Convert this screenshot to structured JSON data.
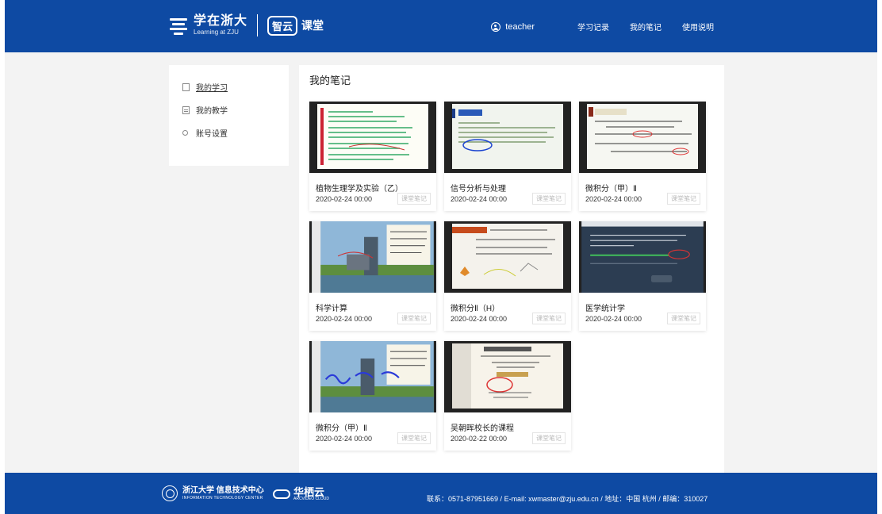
{
  "header": {
    "brand_cn": "学在浙大",
    "brand_en": "Learning at ZJU",
    "zy_box": "智云",
    "zy_text": "课堂",
    "user_name": "teacher",
    "nav": [
      "学习记录",
      "我的笔记",
      "使用说明"
    ]
  },
  "sidebar": {
    "items": [
      {
        "label": "我的学习",
        "icon": "book-icon"
      },
      {
        "label": "我的教学",
        "icon": "notebook-icon"
      },
      {
        "label": "账号设置",
        "icon": "person-icon"
      }
    ]
  },
  "main": {
    "title": "我的笔记",
    "cards": [
      {
        "title": "植物生理学及实验（乙）",
        "date": "2020-02-24 00:00",
        "tag": "课堂笔记"
      },
      {
        "title": "信号分析与处理",
        "date": "2020-02-24 00:00",
        "tag": "课堂笔记"
      },
      {
        "title": "微积分（甲）Ⅱ",
        "date": "2020-02-24 00:00",
        "tag": "课堂笔记"
      },
      {
        "title": "科学计算",
        "date": "2020-02-24 00:00",
        "tag": "课堂笔记"
      },
      {
        "title": "微积分Ⅱ（H）",
        "date": "2020-02-24 00:00",
        "tag": "课堂笔记"
      },
      {
        "title": "医学统计学",
        "date": "2020-02-24 00:00",
        "tag": "课堂笔记"
      },
      {
        "title": "微积分（甲）Ⅱ",
        "date": "2020-02-24 00:00",
        "tag": "课堂笔记"
      },
      {
        "title": "吴朝晖校长的课程",
        "date": "2020-02-22 00:00",
        "tag": "课堂笔记"
      }
    ]
  },
  "footer": {
    "org_cn": "浙江大学 信息技术中心",
    "org_en": "INFORMATION TECHNOLOGY CENTER",
    "brand": "华栖云",
    "brand_sub": "ARCVIDEO CLOUD",
    "contact": "联系：0571-87951669 / E-mail: xwmaster@zju.edu.cn / 地址：中国 杭州 / 邮编：310027"
  }
}
